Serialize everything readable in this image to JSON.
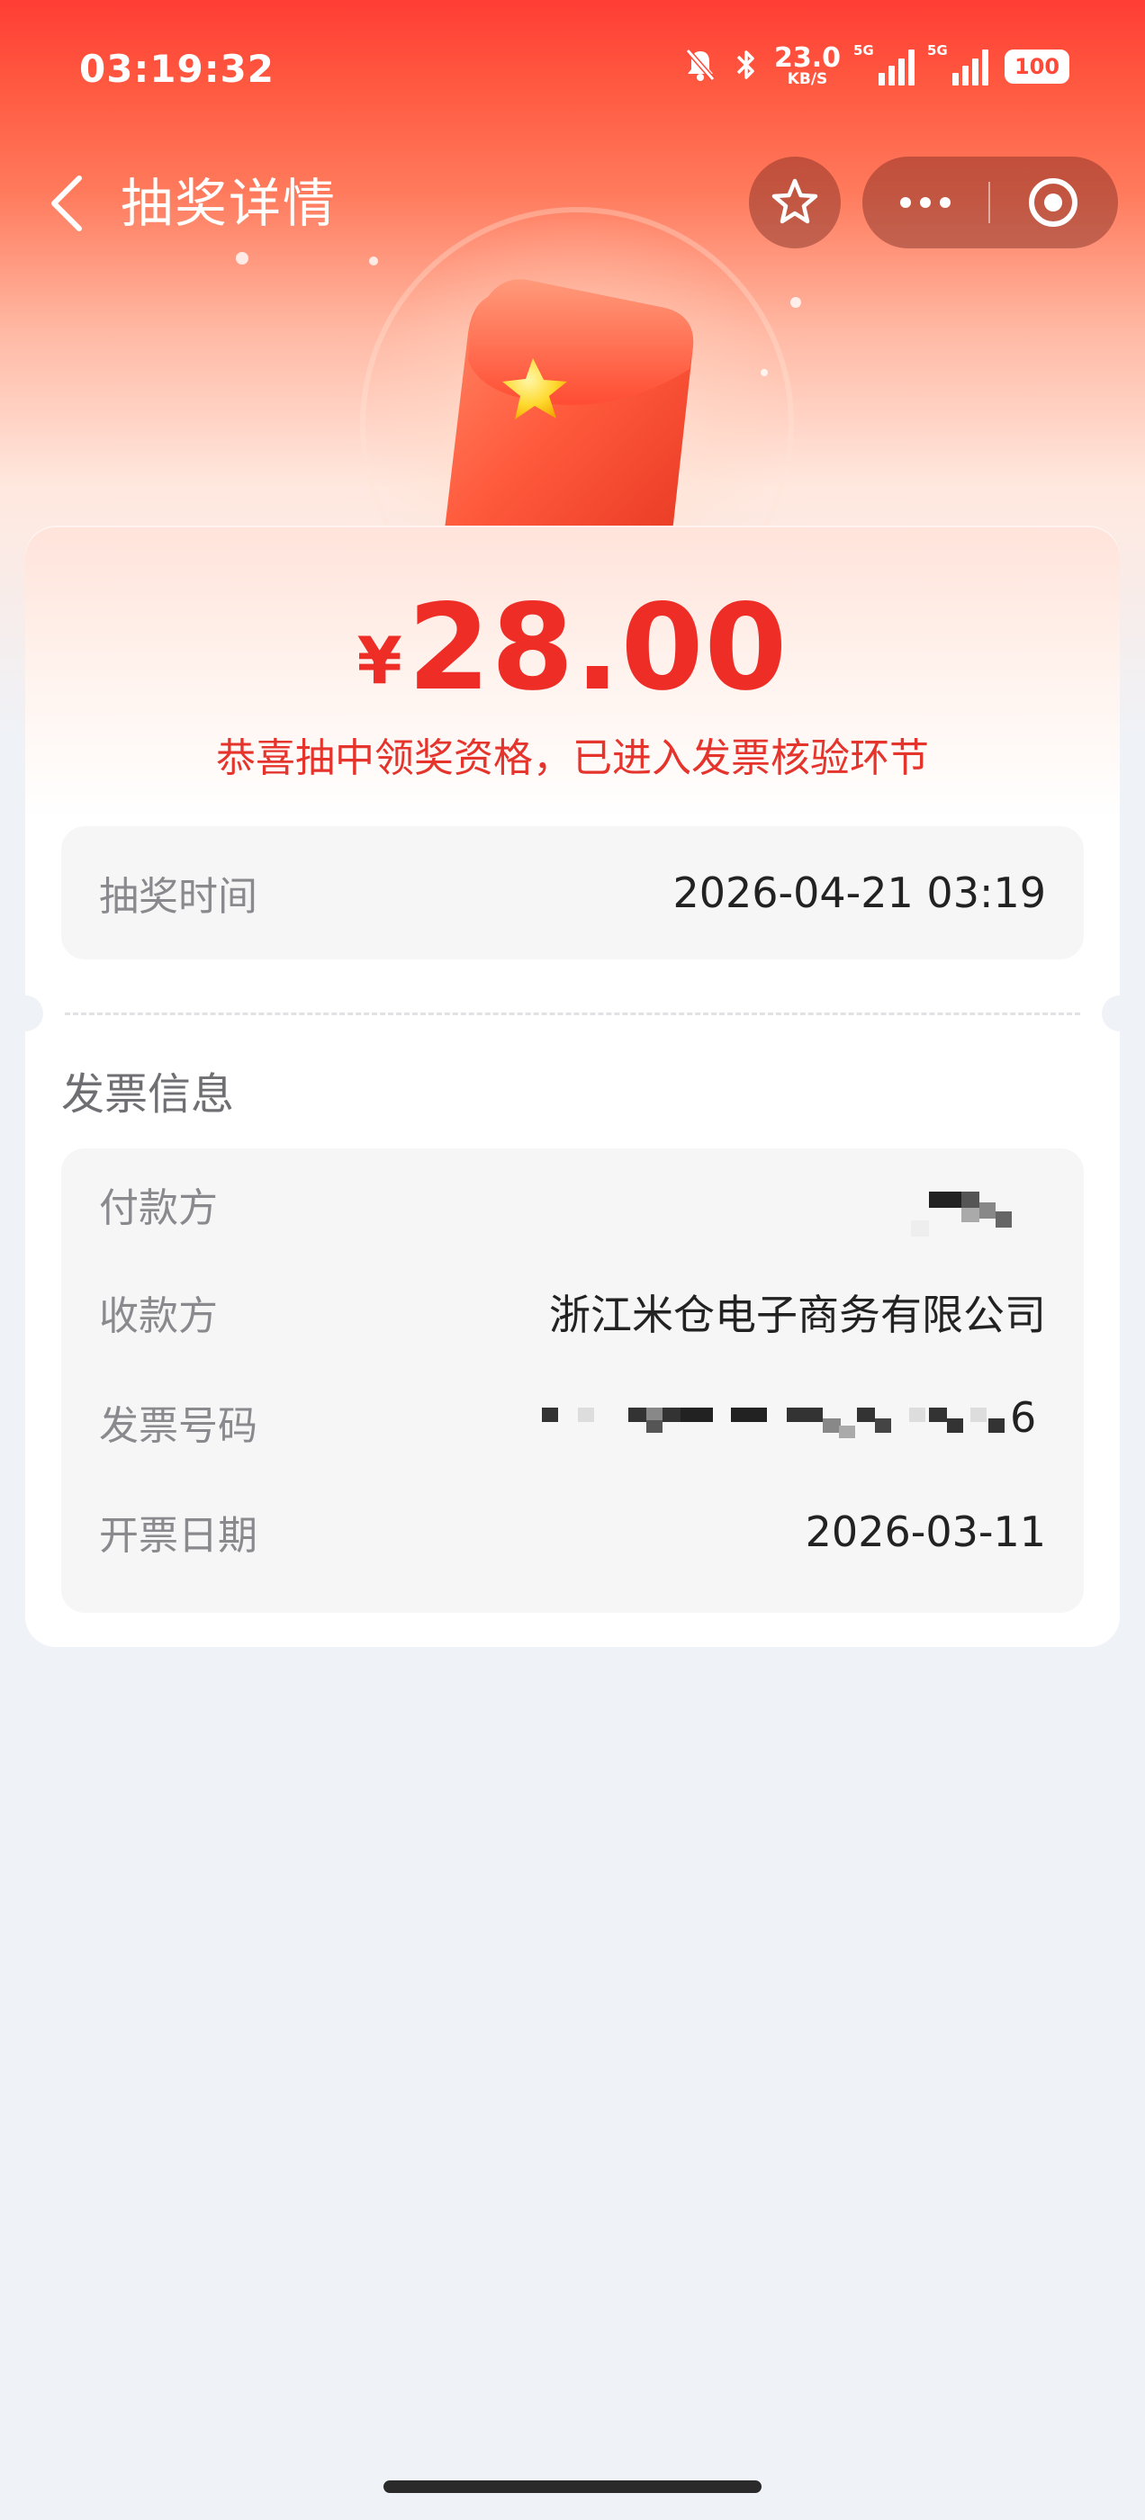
{
  "status_bar": {
    "time": "03:19:32",
    "net_speed": "23.0",
    "net_unit": "KB/S",
    "sig1_label": "5G",
    "sig2_label": "5G",
    "battery": "100"
  },
  "nav": {
    "title": "抽奖详情"
  },
  "prize": {
    "currency": "¥",
    "amount": "28.00",
    "message": "恭喜抽中领奖资格，已进入发票核验环节"
  },
  "draw": {
    "label": "抽奖时间",
    "value": "2026-04-21 03:19"
  },
  "invoice": {
    "section_title": "发票信息",
    "rows": [
      {
        "label": "付款方",
        "value": ""
      },
      {
        "label": "收款方",
        "value": "浙江米仓电子商务有限公司"
      },
      {
        "label": "发票号码",
        "value": "6"
      },
      {
        "label": "开票日期",
        "value": "2026-03-11"
      }
    ]
  },
  "colors": {
    "accent": "#ee2d27",
    "header_red": "#ff3d34",
    "page_bg": "#eff2f7"
  }
}
